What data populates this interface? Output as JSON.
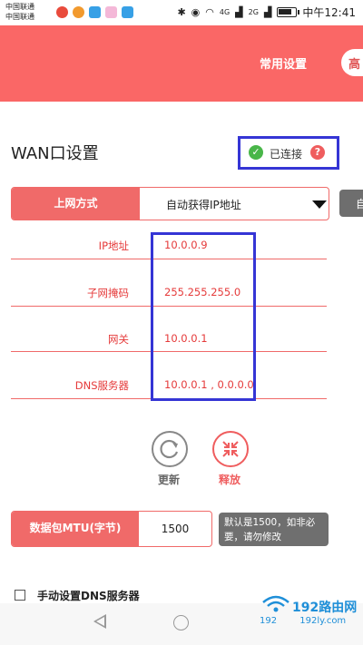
{
  "status_bar": {
    "carrier_1": "中国联通",
    "carrier_2": "中国联通",
    "signal_labels": [
      "4G",
      "2G"
    ],
    "time": "中午12:41",
    "battery_level": 0.8
  },
  "header": {
    "nav_common": "常用设置",
    "nav_advanced": "高"
  },
  "wan": {
    "title": "WAN口设置",
    "status": "已连接",
    "help_glyph": "?",
    "connection_type_label": "上网方式",
    "connection_type_value": "自动获得IP地址",
    "side_button": "自",
    "rows": [
      {
        "label": "IP地址",
        "value": "10.0.0.9"
      },
      {
        "label": "子网掩码",
        "value": "255.255.255.0"
      },
      {
        "label": "网关",
        "value": "10.0.0.1"
      },
      {
        "label": "DNS服务器",
        "value": "10.0.0.1 , 0.0.0.0"
      }
    ]
  },
  "actions": {
    "renew": "更新",
    "release": "释放"
  },
  "mtu": {
    "label": "数据包MTU(字节)",
    "value": "1500",
    "hint": "默认是1500，如非必要，请勿修改"
  },
  "dns_manual": {
    "label": "手动设置DNS服务器",
    "checked": false
  },
  "watermark": {
    "brand": "192路由网",
    "url": "192ly.com",
    "prefix": "192"
  },
  "colors": {
    "accent": "#fa6766",
    "label_red": "#e53a3a",
    "annotation_blue": "#3535d5",
    "ok_green": "#49b649"
  }
}
